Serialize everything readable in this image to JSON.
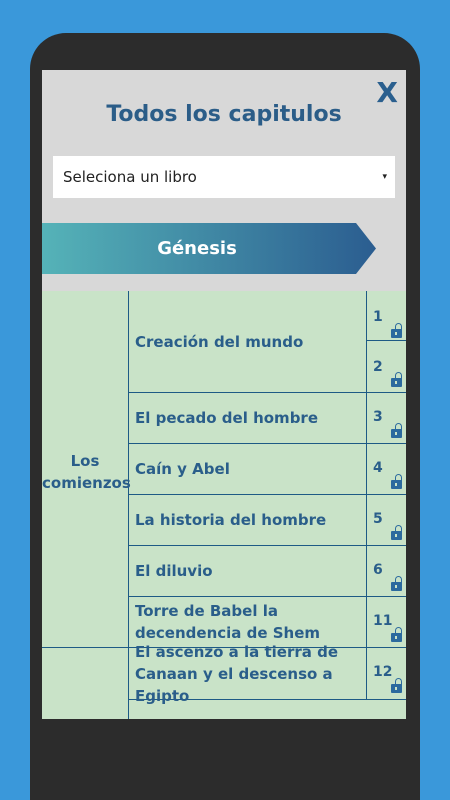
{
  "header": {
    "title": "Todos los capitulos",
    "close_label": "X"
  },
  "book_select": {
    "value": "Seleciona un libro",
    "arrow": "▾"
  },
  "banner": {
    "label": "Génesis"
  },
  "sections": [
    {
      "label": "Los comienzos"
    }
  ],
  "chapters": [
    {
      "title": "Creación del mundo",
      "numbers": [
        "1",
        "2"
      ]
    },
    {
      "title": "El pecado del hombre",
      "numbers": [
        "3"
      ]
    },
    {
      "title": "Caín y Abel",
      "numbers": [
        "4"
      ]
    },
    {
      "title": "La historia del hombre",
      "numbers": [
        "5"
      ]
    },
    {
      "title": "El diluvio",
      "numbers": [
        "6"
      ]
    },
    {
      "title": "Torre de Babel la decendencia de Shem",
      "numbers": [
        "11"
      ]
    },
    {
      "title": "El ascenzo a la tierra de Canaan y el descenso a Egipto",
      "numbers": [
        "12"
      ]
    }
  ],
  "colors": {
    "background": "#3a98da",
    "accent": "#2b5d88",
    "table_bg": "#c9e3c8"
  }
}
